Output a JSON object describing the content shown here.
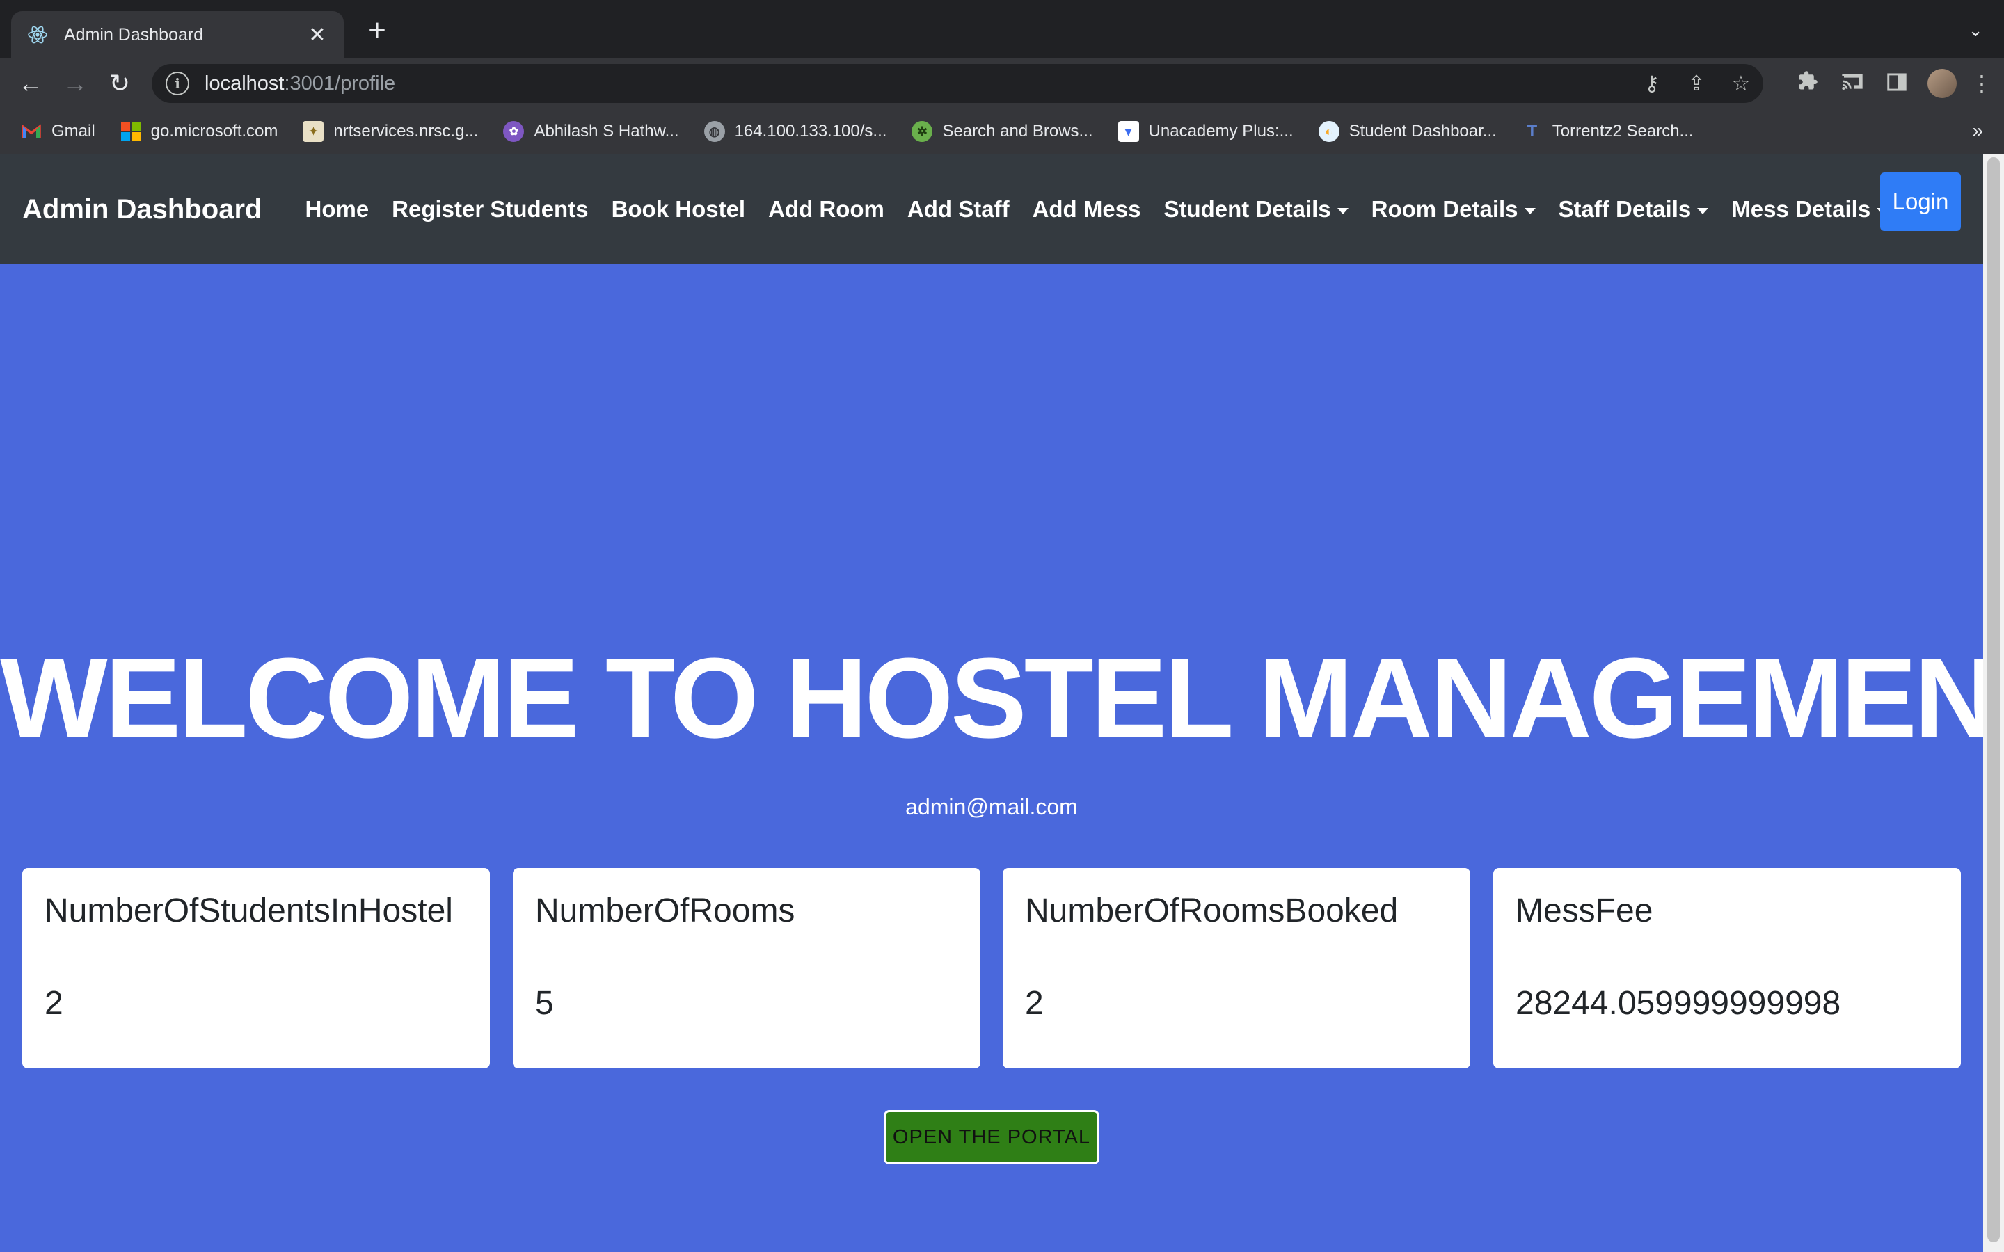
{
  "browser": {
    "tab_title": "Admin Dashboard",
    "url_host": "localhost",
    "url_rest": ":3001/profile",
    "bookmarks": [
      {
        "label": "Gmail",
        "icon": "gmail-icon",
        "color": "#ea4335"
      },
      {
        "label": "go.microsoft.com",
        "icon": "microsoft-icon",
        "color": "#f25022"
      },
      {
        "label": "nrtservices.nrsc.g...",
        "icon": "nrsc-icon",
        "color": "#c9a227"
      },
      {
        "label": "Abhilash S Hathw...",
        "icon": "profile-badge-icon",
        "color": "#7e57c2"
      },
      {
        "label": "164.100.133.100/s...",
        "icon": "globe-icon",
        "color": "#9aa0a6"
      },
      {
        "label": "Search and Brows...",
        "icon": "film-reel-icon",
        "color": "#6ab04c"
      },
      {
        "label": "Unacademy Plus:...",
        "icon": "unacademy-icon",
        "color": "#ffffff"
      },
      {
        "label": "Student Dashboar...",
        "icon": "dashboard-icon",
        "color": "#4fc3f7"
      },
      {
        "label": "Torrentz2 Search...",
        "icon": "torrentz-icon",
        "color": "#5b7ec9"
      }
    ]
  },
  "navbar": {
    "brand": "Admin Dashboard",
    "links": [
      "Home",
      "Register Students",
      "Book Hostel",
      "Add Room",
      "Add Staff",
      "Add Mess"
    ],
    "dropdowns": [
      "Student Details",
      "Room Details",
      "Staff Details",
      "Mess Details"
    ],
    "login": "Login"
  },
  "hero": {
    "title": "WELCOME TO HOSTEL MANAGEMENT",
    "email": "admin@mail.com"
  },
  "cards": [
    {
      "title": "NumberOfStudentsInHostel",
      "value": "2"
    },
    {
      "title": "NumberOfRooms",
      "value": "5"
    },
    {
      "title": "NumberOfRoomsBooked",
      "value": "2"
    },
    {
      "title": "MessFee",
      "value": "28244.059999999998"
    }
  ],
  "portal_button": "OPEN THE PORTAL",
  "colors": {
    "page_bg": "#4a68dc",
    "navbar_bg": "#343a40",
    "login_bg": "#2f7cf6",
    "portal_bg": "#2f7f16"
  }
}
